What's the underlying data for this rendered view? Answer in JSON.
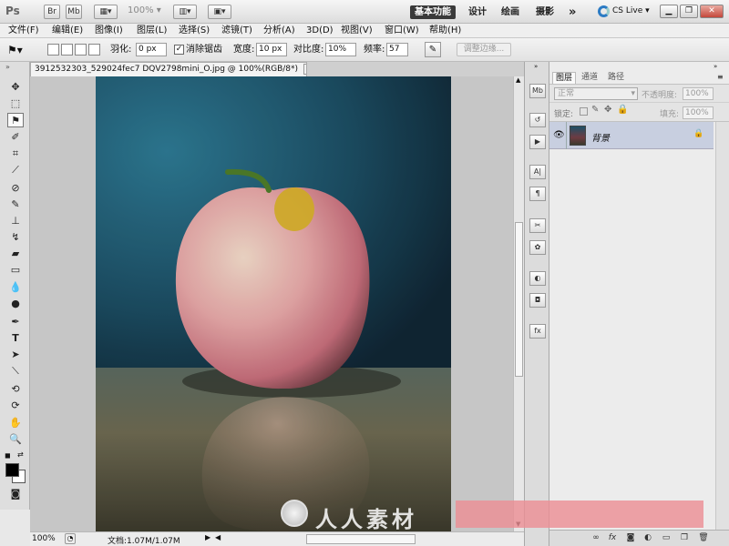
{
  "app_bar": {
    "logo": "Ps",
    "br_label": "Br",
    "mb_label": "Mb",
    "zoom": "100%",
    "workspaces": [
      "基本功能",
      "设计",
      "绘画",
      "摄影"
    ],
    "more": "»",
    "cs_live": "CS Live"
  },
  "menu": [
    "文件(F)",
    "编辑(E)",
    "图像(I)",
    "图层(L)",
    "选择(S)",
    "滤镜(T)",
    "分析(A)",
    "3D(D)",
    "视图(V)",
    "窗口(W)",
    "帮助(H)"
  ],
  "options": {
    "feather_label": "羽化:",
    "feather_value": "0 px",
    "antialias_label": "消除锯齿",
    "antialias_checked": true,
    "width_label": "宽度:",
    "width_value": "10 px",
    "contrast_label": "对比度:",
    "contrast_value": "10%",
    "frequency_label": "频率:",
    "frequency_value": "57",
    "refine_edge": "调整边缘..."
  },
  "document": {
    "tab_title": "3912532303_529024fec7 DQV2798mini_O.jpg @ 100%(RGB/8*)",
    "close": "×"
  },
  "status": {
    "zoom": "100%",
    "doc_info": "文档:1.07M/1.07M"
  },
  "layers_panel": {
    "tabs": [
      "图层",
      "通道",
      "路径"
    ],
    "blend_mode": "正常",
    "opacity_label": "不透明度:",
    "opacity_value": "100%",
    "lock_label": "锁定:",
    "fill_label": "填充:",
    "fill_value": "100%",
    "layers": [
      {
        "name": "背景",
        "visible": true,
        "locked": true
      }
    ]
  },
  "watermark": {
    "text": "人人素材"
  },
  "colors": {
    "foreground": "#000000",
    "background": "#ffffff",
    "layer_selected": "#c8cfe0",
    "workspace_active": "#3a3a3a"
  }
}
